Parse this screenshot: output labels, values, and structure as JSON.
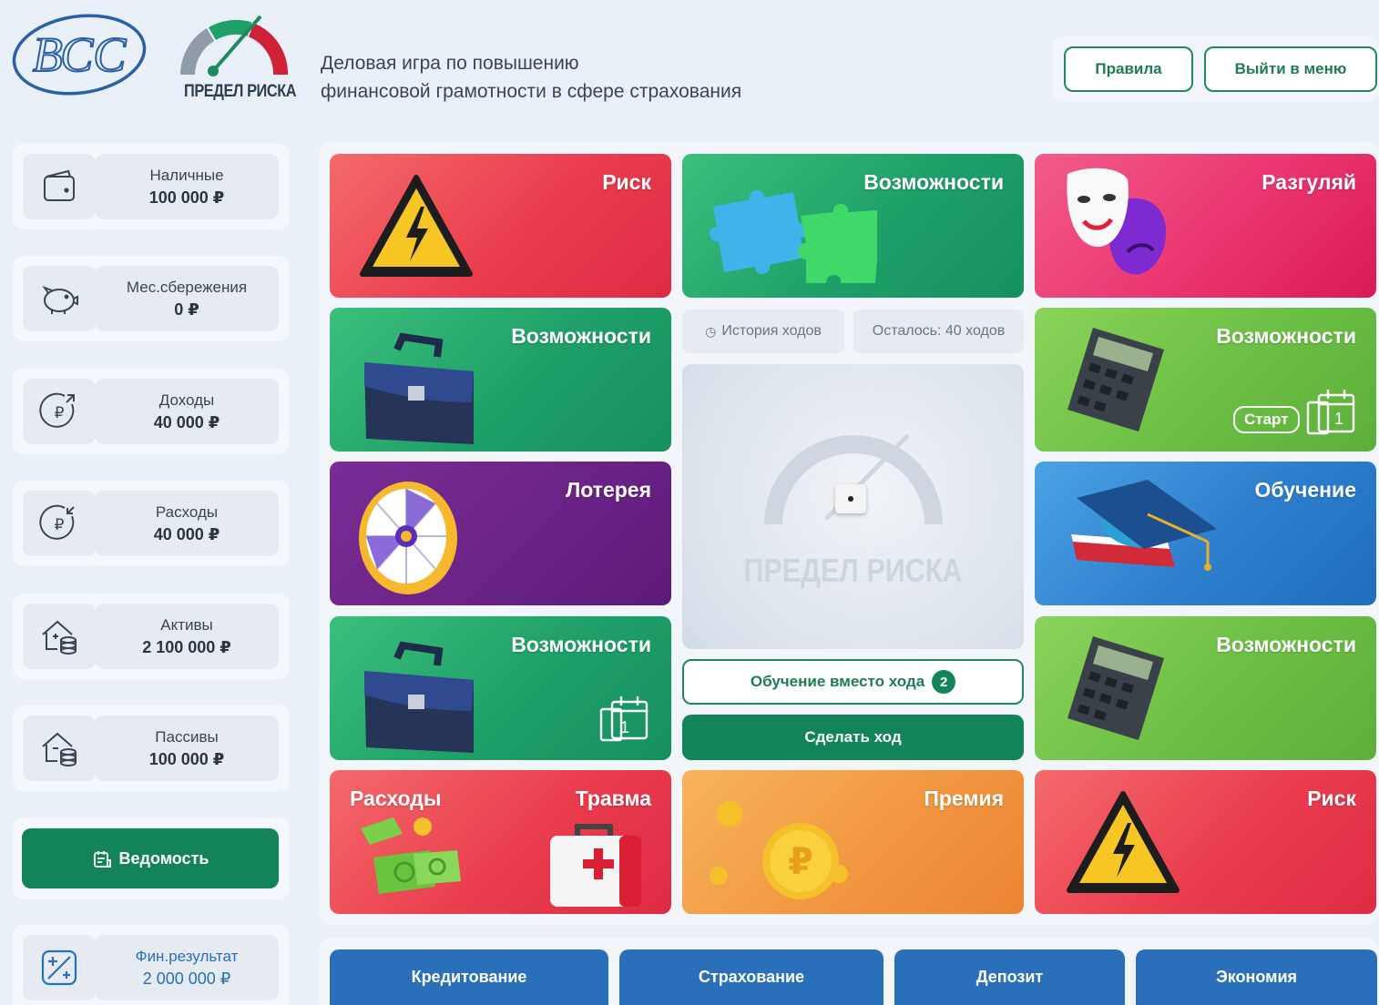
{
  "header": {
    "logo_text": "ВСС",
    "game_logo_text": "ПРЕДЕЛ РИСКА",
    "tagline_line1": "Деловая игра по повышению",
    "tagline_line2": "финансовой грамотности в сфере страхования",
    "rules_label": "Правила",
    "exit_label": "Выйти в меню"
  },
  "stats": [
    {
      "label": "Наличные",
      "value": "100 000 ₽",
      "icon": "wallet-icon"
    },
    {
      "label": "Мес.сбережения",
      "value": "0 ₽",
      "icon": "piggy-bank-icon"
    },
    {
      "label": "Доходы",
      "value": "40 000 ₽",
      "icon": "income-icon"
    },
    {
      "label": "Расходы",
      "value": "40 000 ₽",
      "icon": "expense-icon"
    },
    {
      "label": "Активы",
      "value": "2 100 000 ₽",
      "icon": "assets-icon"
    },
    {
      "label": "Пассивы",
      "value": "100 000 ₽",
      "icon": "liabilities-icon"
    }
  ],
  "ledger_label": "Ведомость",
  "fin_result": {
    "label": "Фин.результат",
    "value": "2 000 000 ₽"
  },
  "tiles": {
    "r1c1": "Риск",
    "r1c2": "Возможности",
    "r1c3": "Разгуляй",
    "r2c1": "Возможности",
    "r2c3": "Возможности",
    "r2c3_chip": "Старт",
    "r3c1": "Лотерея",
    "r3c3": "Обучение",
    "r4c1": "Возможности",
    "r4c3": "Возможности",
    "r5c1_left": "Расходы",
    "r5c1_right": "Травма",
    "r5c2": "Премия",
    "r5c3": "Риск",
    "calendar_day": "1"
  },
  "center": {
    "history_label": "История ходов",
    "remaining_label": "Осталось: 40 ходов",
    "watermark": "ПРЕДЕЛ РИСКА",
    "learn_label": "Обучение вместо хода",
    "learn_badge": "2",
    "move_label": "Сделать ход"
  },
  "bottom": [
    "Кредитование",
    "Страхование",
    "Депозит",
    "Экономия"
  ],
  "colors": {
    "accent_green": "#128457",
    "accent_blue": "#2a6fba",
    "bg": "#eaf0f7"
  }
}
